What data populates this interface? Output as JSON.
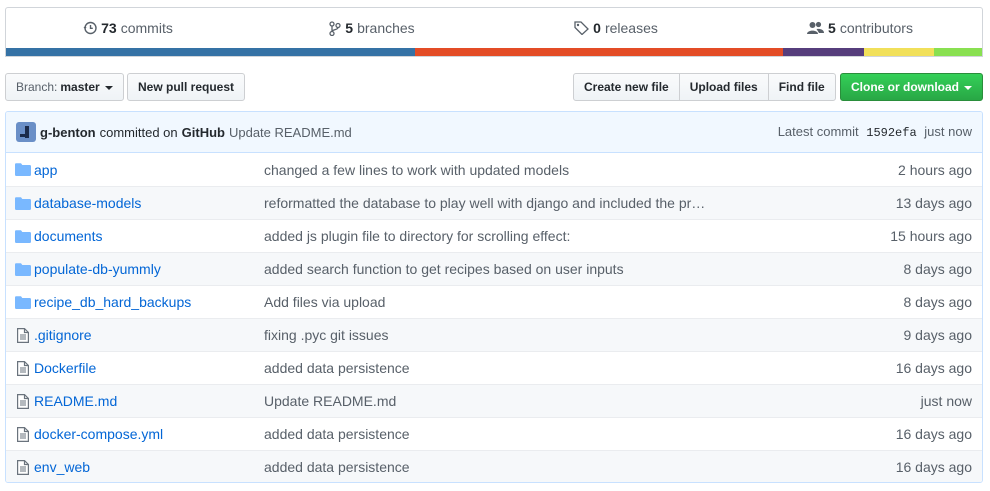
{
  "summary": {
    "commits": {
      "count": "73",
      "label": "commits",
      "icon": "history-icon"
    },
    "branches": {
      "count": "5",
      "label": "branches",
      "icon": "branch-icon"
    },
    "releases": {
      "count": "0",
      "label": "releases",
      "icon": "tag-icon"
    },
    "contributors": {
      "count": "5",
      "label": "contributors",
      "icon": "people-icon"
    },
    "language_bar": [
      {
        "color": "#3572A5",
        "percent": 41.9
      },
      {
        "color": "#e34c26",
        "percent": 37.7
      },
      {
        "color": "#563d7c",
        "percent": 8.3
      },
      {
        "color": "#f1e05a",
        "percent": 7.2
      },
      {
        "color": "#89e051",
        "percent": 4.9
      }
    ]
  },
  "toolbar": {
    "branch_prefix": "Branch:",
    "branch_name": "master",
    "new_pull_request": "New pull request",
    "create_new_file": "Create new file",
    "upload_files": "Upload files",
    "find_file": "Find file",
    "clone_or_download": "Clone or download"
  },
  "commit": {
    "author": "g-benton",
    "via": "committed on",
    "platform": "GitHub",
    "message": "Update README.md",
    "latest_label": "Latest commit",
    "sha": "1592efa",
    "time": "just now"
  },
  "files": [
    {
      "type": "dir",
      "name": "app",
      "message": "changed a few lines to work with updated models",
      "age": "2 hours ago"
    },
    {
      "type": "dir",
      "name": "database-models",
      "message": "reformatted the database to play well with django and included the pr…",
      "age": "13 days ago"
    },
    {
      "type": "dir",
      "name": "documents",
      "message": "added js plugin file to directory for scrolling effect:",
      "age": "15 hours ago"
    },
    {
      "type": "dir",
      "name": "populate-db-yummly",
      "message": "added search function to get recipes based on user inputs",
      "age": "8 days ago"
    },
    {
      "type": "dir",
      "name": "recipe_db_hard_backups",
      "message": "Add files via upload",
      "age": "8 days ago"
    },
    {
      "type": "file",
      "name": ".gitignore",
      "message": "fixing .pyc git issues",
      "age": "9 days ago"
    },
    {
      "type": "file",
      "name": "Dockerfile",
      "message": "added data persistence",
      "age": "16 days ago"
    },
    {
      "type": "file",
      "name": "README.md",
      "message": "Update README.md",
      "age": "just now"
    },
    {
      "type": "file",
      "name": "docker-compose.yml",
      "message": "added data persistence",
      "age": "16 days ago"
    },
    {
      "type": "file",
      "name": "env_web",
      "message": "added data persistence",
      "age": "16 days ago"
    }
  ]
}
